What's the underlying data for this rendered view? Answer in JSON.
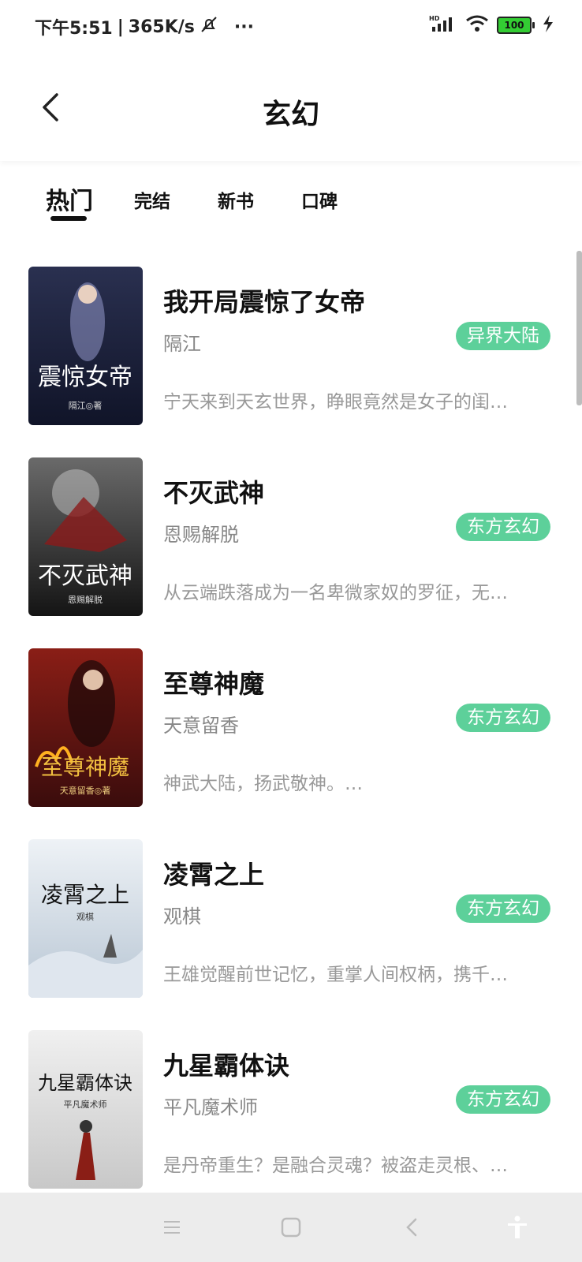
{
  "status": {
    "time": "下午5:51",
    "speed": "365K/s",
    "battery": "100",
    "hd": "HD",
    "more": "···"
  },
  "header": {
    "title": "玄幻"
  },
  "tabs": [
    {
      "label": "热门"
    },
    {
      "label": "完结"
    },
    {
      "label": "新书"
    },
    {
      "label": "口碑"
    }
  ],
  "books": [
    {
      "title": "我开局震惊了女帝",
      "author": "隔江",
      "tag": "异界大陆",
      "desc": "宁天来到天玄世界，睁眼竟然是女子的闺…",
      "cover_text": "震惊女帝",
      "cover_sub": "隔江◎著",
      "colors": [
        "#101428",
        "#2a3050"
      ]
    },
    {
      "title": "不灭武神",
      "author": "恩赐解脱",
      "tag": "东方玄幻",
      "desc": "从云端跌落成为一名卑微家奴的罗征，无…",
      "cover_text": "不灭武神",
      "cover_sub": "恩赐解脱",
      "colors": [
        "#1a1a1a",
        "#5a5a5a"
      ]
    },
    {
      "title": "至尊神魔",
      "author": "天意留香",
      "tag": "东方玄幻",
      "desc": "神武大陆，扬武敬神。…",
      "cover_text": "至尊神魔",
      "cover_sub": "天意留香◎著",
      "colors": [
        "#3a0c0c",
        "#8a1e16"
      ]
    },
    {
      "title": "凌霄之上",
      "author": "观棋",
      "tag": "东方玄幻",
      "desc": "王雄觉醒前世记忆，重掌人间权柄，携千…",
      "cover_text": "凌霄之上",
      "cover_sub": "观棋",
      "colors": [
        "#cfd8e2",
        "#eef2f6"
      ]
    },
    {
      "title": "九星霸体诀",
      "author": "平凡魔术师",
      "tag": "东方玄幻",
      "desc": "是丹帝重生？是融合灵魂？被盗走灵根、…",
      "cover_text": "九星霸体诀",
      "cover_sub": "平凡魔术师",
      "colors": [
        "#e6e6e6",
        "#c8c8c8"
      ]
    }
  ],
  "nav": {
    "menu": "menu-icon",
    "home": "home-icon",
    "back": "back-icon",
    "accessibility": "accessibility-icon"
  }
}
